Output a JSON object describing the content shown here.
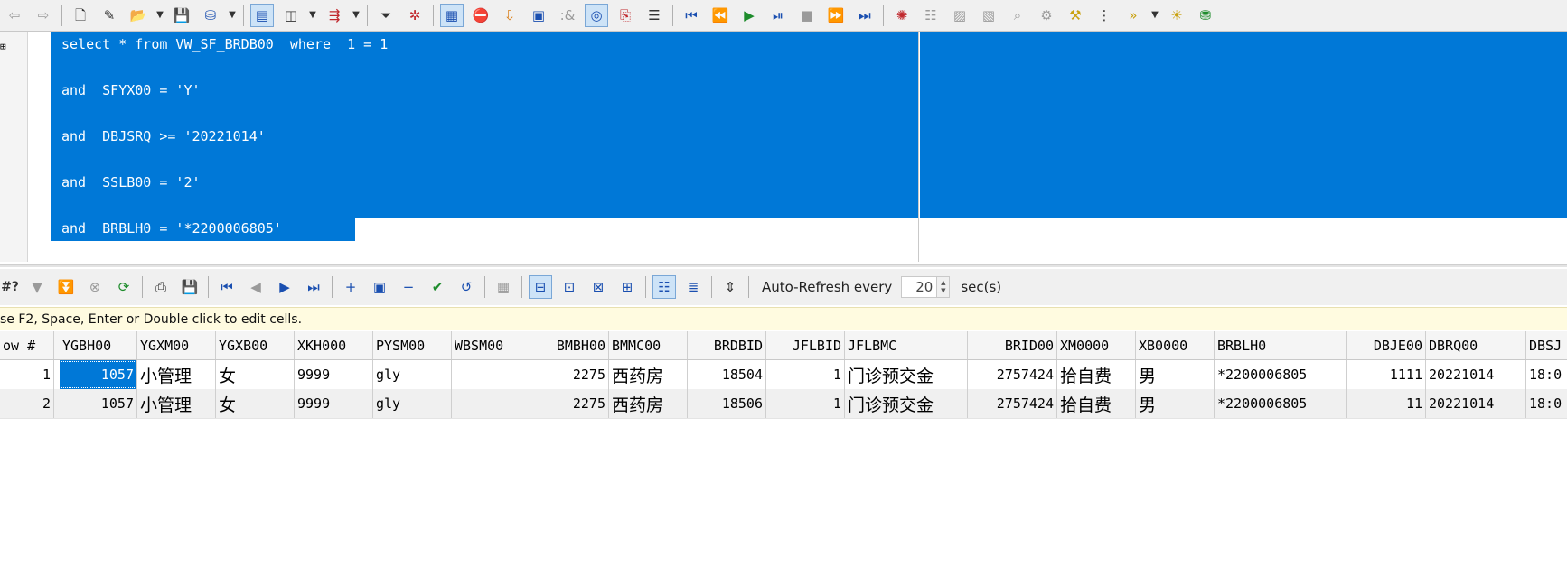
{
  "toolbar_top": {
    "icons": [
      "back-arrow-icon",
      "forward-arrow-icon",
      "new-file-icon",
      "edit-file-icon",
      "open-folder-icon",
      "dropdown-arrow-icon",
      "save-icon",
      "save-as-icon",
      "dropdown-arrow-icon",
      "text-select-icon",
      "window-icon",
      "dropdown-arrow-icon",
      "export-icon",
      "dropdown-arrow-icon",
      "filter-icon",
      "clear-filter-icon",
      "execute-icon",
      "stop-icon",
      "fetch-icon",
      "query-icon",
      "ampersand-icon",
      "explain-icon",
      "copy-icon",
      "align-icon",
      "first-icon",
      "previous-icon",
      "run-icon",
      "step-icon",
      "stop-square-icon",
      "next-icon",
      "last-icon",
      "debug-icon",
      "list-icon",
      "lock-icon",
      "unlock-icon",
      "search-icon",
      "config-icon",
      "tools-icon",
      "tree-icon",
      "more-icon",
      "dropdown-arrow-icon",
      "bulb-icon",
      "stack-icon"
    ]
  },
  "editor": {
    "lines": [
      "select * from VW_SF_BRDB00  where  1 = 1",
      "and  SFYX00 = 'Y'",
      "and  DBJSRQ >= '20221014'",
      "and  SSLB00 = '2'",
      "and  BRBLH0 = '*2200006805'"
    ]
  },
  "results_toolbar": {
    "find_label": "#?",
    "auto_refresh_label": "Auto-Refresh every",
    "auto_refresh_value": "20",
    "auto_refresh_unit": "sec(s)"
  },
  "hint_text": "se F2, Space, Enter or Double click to edit cells.",
  "grid": {
    "columns": [
      "ow #",
      "YGBH00",
      "YGXM00",
      "YGXB00",
      "XKH000",
      "PYSM00",
      "WBSM00",
      "BMBH00",
      "BMMC00",
      "BRDBID",
      "JFLBID",
      "JFLBMC",
      "BRID00",
      "XM0000",
      "XB0000",
      "BRBLH0",
      "DBJE00",
      "DBRQ00",
      "DBSJ"
    ],
    "rows": [
      [
        "1",
        "1057",
        "小管理",
        "女",
        "9999",
        "gly",
        "",
        "2275",
        "西药房",
        "18504",
        "1",
        "门诊预交金",
        "2757424",
        "拾自费",
        "男",
        "*2200006805",
        "1111",
        "20221014",
        "18:0"
      ],
      [
        "2",
        "1057",
        "小管理",
        "女",
        "9999",
        "gly",
        "",
        "2275",
        "西药房",
        "18506",
        "1",
        "门诊预交金",
        "2757424",
        "拾自费",
        "男",
        "*2200006805",
        "11",
        "20221014",
        "18:0"
      ]
    ]
  }
}
